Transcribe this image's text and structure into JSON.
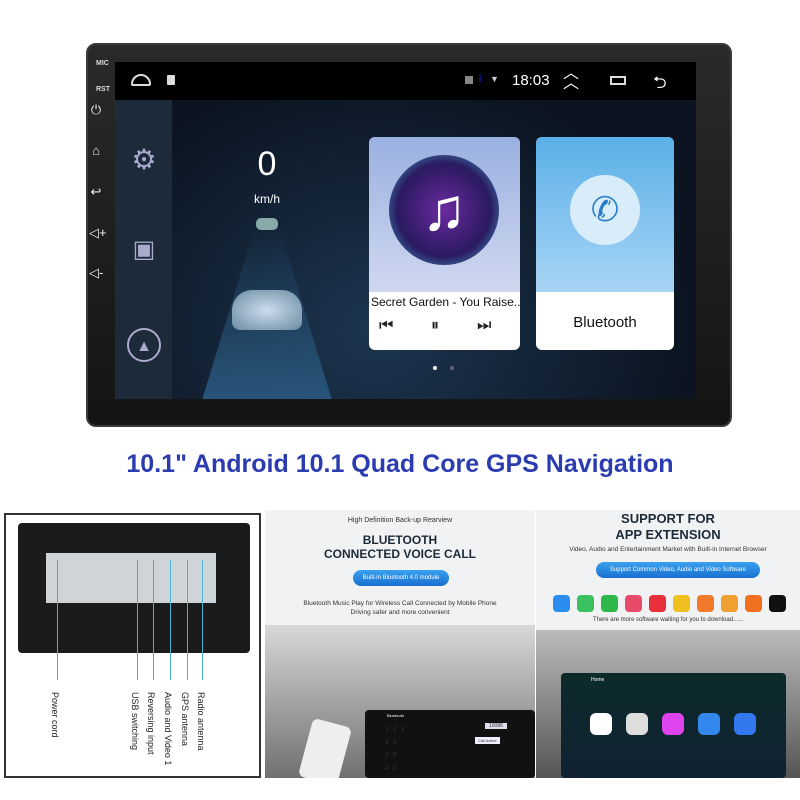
{
  "device": {
    "side_labels": {
      "mic": "MIC",
      "rst": "RST"
    },
    "side_buttons": [
      "power-icon",
      "home-icon",
      "back-icon",
      "volume-up-icon",
      "volume-down-icon"
    ],
    "status_bar": {
      "time": "18:03",
      "icons": [
        "home-icon",
        "notification-icon",
        "no-sim-icon",
        "bluetooth-icon",
        "wifi-icon",
        "chevron-up-icon",
        "recent-apps-icon",
        "back-icon"
      ]
    },
    "sidebar": [
      "settings-icon",
      "apps-grid-icon",
      "navigation-icon"
    ],
    "speed": {
      "value": "0",
      "unit": "km/h"
    },
    "music_card": {
      "track": "Secret Garden - You Raise...",
      "controls": [
        "previous-icon",
        "pause-icon",
        "next-icon"
      ]
    },
    "bluetooth_card": {
      "label": "Bluetooth"
    },
    "page_indicator": {
      "pages": 2,
      "current": 1
    }
  },
  "headline": "10.1\" Android 10.1 Quad Core GPS Navigation",
  "colors": {
    "headline": "#2b3bb0",
    "pill": "#1f7ee0",
    "cable_line": "#4ab0d0"
  },
  "panel_ports": {
    "labels": [
      "Power cord",
      "USB switching",
      "Reversing input",
      "Audio and Video 1",
      "GPS antenna",
      "Radio antenna"
    ]
  },
  "panel_bluetooth": {
    "tagline": "High Definition Back-up Rearview",
    "title_line1": "BLUETOOTH",
    "title_line2": "CONNECTED VOICE CALL",
    "pill": "Built-in Bluetooth 4.0 module",
    "desc_line1": "Bluetooth Music Play for Wireless Call Connected by Mobile Phone",
    "desc_line2": "Driving safer and more convenient",
    "screen_title": "Bluetooth",
    "dial_number": "10086",
    "call_status": "Call Active",
    "keypad": [
      "1",
      "2",
      "3",
      "4",
      "5",
      "7",
      "8",
      "#",
      "0"
    ]
  },
  "panel_apps": {
    "title_line1": "SUPPORT FOR",
    "title_line2": "APP EXTENSION",
    "subtitle": "Video, Audio and Entertainment Market with Built-in Internet Browser",
    "pill": "Support Common Video, Audio and Video Software",
    "footer": "There are more software waiting for you to download......",
    "app_colors": [
      "#2a8ef0",
      "#3bc060",
      "#2fb84a",
      "#e84a6a",
      "#e8303a",
      "#f0c020",
      "#f07a2a",
      "#f0a030",
      "#f07020",
      "#111111"
    ],
    "screen_title": "Home"
  }
}
